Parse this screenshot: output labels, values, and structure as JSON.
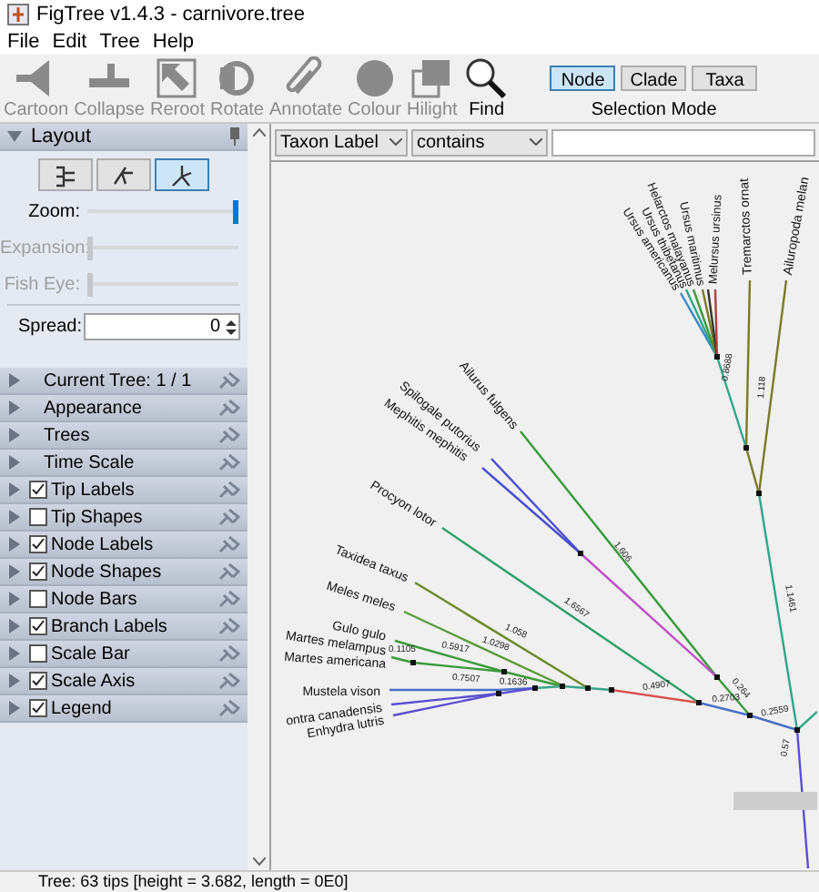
{
  "window": {
    "title": "FigTree v1.4.3 - carnivore.tree"
  },
  "menu": [
    "File",
    "Edit",
    "Tree",
    "Help"
  ],
  "toolbar": [
    {
      "label": "Cartoon",
      "disabled": true
    },
    {
      "label": "Collapse",
      "disabled": true
    },
    {
      "label": "Reroot",
      "disabled": true
    },
    {
      "label": "Rotate",
      "disabled": true
    },
    {
      "label": "Annotate",
      "disabled": true
    },
    {
      "label": "Colour",
      "disabled": true
    },
    {
      "label": "Hilight",
      "disabled": true
    },
    {
      "label": "Find",
      "disabled": false
    }
  ],
  "selection_mode": {
    "label": "Selection Mode",
    "options": [
      {
        "label": "Node",
        "selected": true
      },
      {
        "label": "Clade",
        "selected": false
      },
      {
        "label": "Taxa",
        "selected": false
      }
    ]
  },
  "layout": {
    "title": "Layout",
    "modes": [
      {
        "selected": false
      },
      {
        "selected": false
      },
      {
        "selected": true
      }
    ],
    "sliders": [
      {
        "label": "Zoom:",
        "level": 1,
        "disabled": false
      },
      {
        "label": "Expansion:",
        "level": 0,
        "disabled": true
      },
      {
        "label": "Fish Eye:",
        "level": 0,
        "disabled": true
      }
    ],
    "spread": {
      "label": "Spread:",
      "value": "0"
    }
  },
  "sections": [
    {
      "kind": "plain",
      "label": "Current Tree: 1 / 1"
    },
    {
      "kind": "plain",
      "label": "Appearance"
    },
    {
      "kind": "plain",
      "label": "Trees"
    },
    {
      "kind": "plain",
      "label": "Time Scale"
    },
    {
      "kind": "check",
      "label": "Tip Labels",
      "checked": true
    },
    {
      "kind": "check",
      "label": "Tip Shapes",
      "checked": false
    },
    {
      "kind": "check",
      "label": "Node Labels",
      "checked": true
    },
    {
      "kind": "check",
      "label": "Node Shapes",
      "checked": true
    },
    {
      "kind": "check",
      "label": "Node Bars",
      "checked": false
    },
    {
      "kind": "check",
      "label": "Branch Labels",
      "checked": true
    },
    {
      "kind": "check",
      "label": "Scale Bar",
      "checked": false
    },
    {
      "kind": "check",
      "label": "Scale Axis",
      "checked": true
    },
    {
      "kind": "check",
      "label": "Legend",
      "checked": true
    }
  ],
  "filter": {
    "field": "Taxon Label",
    "operator": "contains"
  },
  "tree": {
    "tips": [
      "Ailurus fulgens",
      "Spilogale putorius",
      "Mephitis mephitis",
      "Procyon lotor",
      "Taxidea taxus",
      "Meles meles",
      "Gulo gulo",
      "Martes melampus",
      "Martes americana",
      "Mustela vison",
      "ontra canadensis",
      "Enhydra lutris",
      "Ursus americanus",
      "Ursus thibetanus",
      "Helarctos malayanus",
      "Ursus maritimus",
      "Melursus ursinus",
      "Tremarctos ornat",
      "Ailuropoda melan"
    ],
    "branch_labels": [
      "1.606",
      "1.6567",
      "1.058",
      "1.0298",
      "0.5917",
      "0.7507",
      "0.1105",
      "0.1636",
      "0.4907",
      "0.2703",
      "0.264",
      "0.2559",
      "1.1461",
      "0.57",
      "0.8688",
      "1.118"
    ]
  },
  "status_bar": "Tree: 63 tips [height = 3.682, length = 0E0]"
}
